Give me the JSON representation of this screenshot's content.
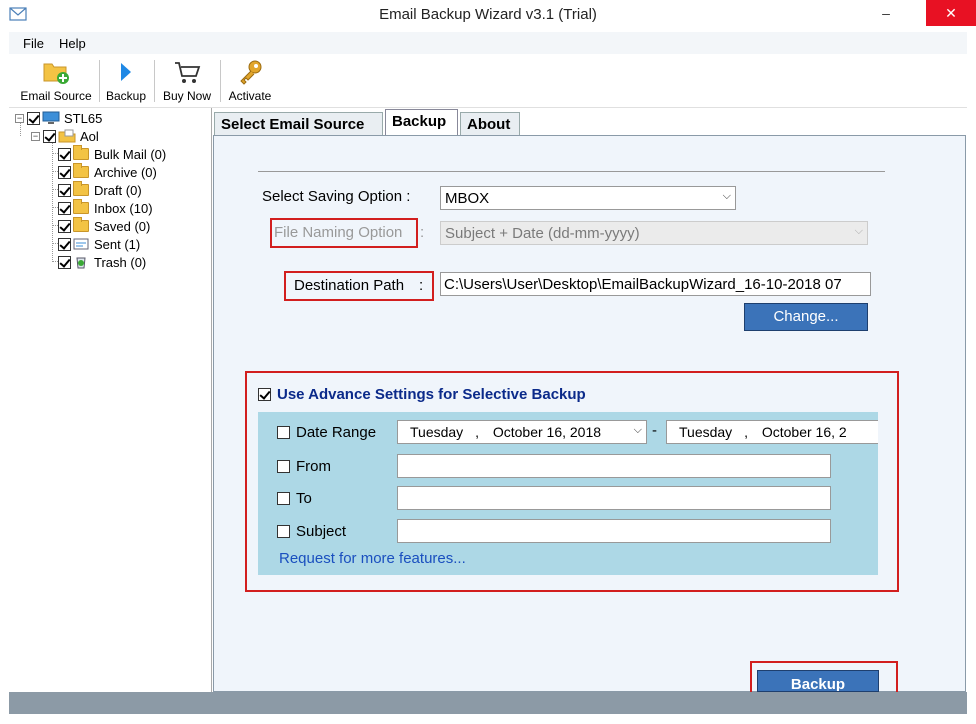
{
  "window": {
    "title": "Email Backup Wizard v3.1 (Trial)",
    "minimize": "–",
    "maximize": "□",
    "close": "✕"
  },
  "menu": {
    "file": "File",
    "help": "Help"
  },
  "toolbar": {
    "email_source": "Email Source",
    "backup": "Backup",
    "buy_now": "Buy Now",
    "activate": "Activate"
  },
  "tree": {
    "root": "STL65",
    "account": "Aol",
    "folders": [
      {
        "label": "Bulk Mail (0)"
      },
      {
        "label": "Archive (0)"
      },
      {
        "label": "Draft (0)"
      },
      {
        "label": "Inbox (10)"
      },
      {
        "label": "Saved (0)"
      },
      {
        "label": "Sent (1)"
      },
      {
        "label": "Trash (0)"
      }
    ]
  },
  "tabs": {
    "select_email_source": "Select Email Source",
    "backup": "Backup",
    "about": "About"
  },
  "form": {
    "saving_option_label": "Select Saving Option :",
    "saving_option_value": "MBOX",
    "file_naming_label": "File Naming Option",
    "file_naming_colon": ":",
    "file_naming_value": "Subject + Date (dd-mm-yyyy)",
    "destination_label": "Destination Path",
    "destination_colon": ":",
    "destination_value": "C:\\Users\\User\\Desktop\\EmailBackupWizard_16-10-2018 07",
    "change_button": "Change..."
  },
  "advanced": {
    "label": "Use Advance Settings for Selective Backup",
    "checked": true,
    "date_range_label": "Date Range",
    "date_from_day": "Tuesday",
    "date_from_sep": ",",
    "date_from_rest": "October   16, 2018",
    "date_dash": "-",
    "date_to_day": "Tuesday",
    "date_to_sep": ",",
    "date_to_rest": "October   16, 2",
    "from_label": "From",
    "to_label": "To",
    "subject_label": "Subject",
    "more_features_link": "Request for more features..."
  },
  "backup_button": "Backup",
  "colors": {
    "accent_red": "#d21e1e",
    "button_blue": "#3b73b9",
    "panel_blue": "#add8e6",
    "link_blue": "#1a4fbf"
  }
}
